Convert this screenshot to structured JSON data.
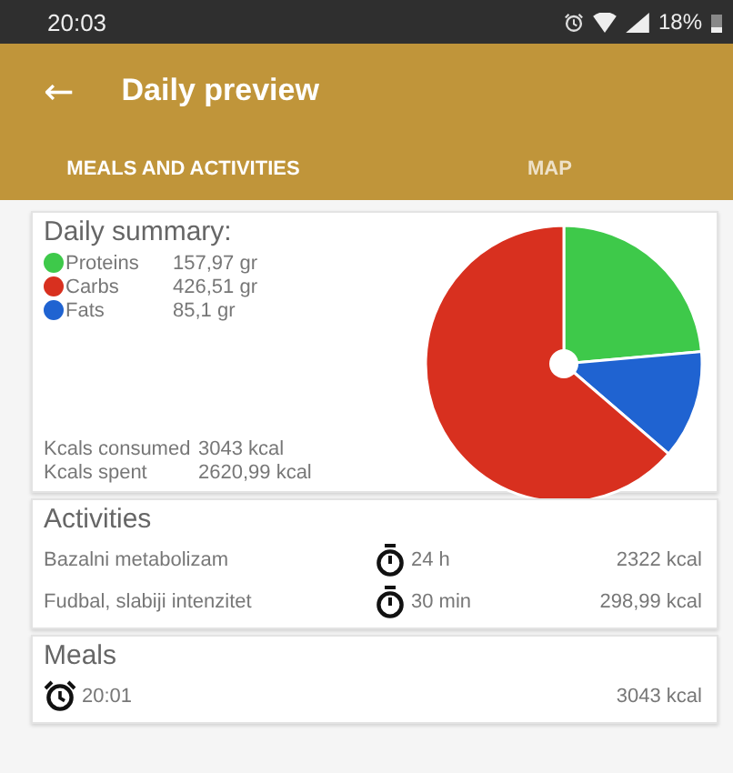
{
  "status_bar": {
    "time": "20:03",
    "battery": "18%"
  },
  "toolbar": {
    "back": "←",
    "title": "Daily preview"
  },
  "tabs": [
    {
      "label": "MEALS AND ACTIVITIES",
      "selected": true
    },
    {
      "label": "MAP",
      "selected": false
    }
  ],
  "summary": {
    "title": "Daily summary:",
    "macros": [
      {
        "amount": "157,97 gr",
        "color": "#3ec94a"
      },
      {
        "amount": "426,51 gr",
        "color": "#d8301f"
      },
      {
        "amount": "85,1 gr",
        "color": "#1f63d1"
      }
    ],
    "totals": [
      {
        "label": "Kcals consumed",
        "value": "3043 kcal"
      },
      {
        "label": "Kcals spent",
        "value": "2620,99 kcal"
      }
    ],
    "chart_data": {
      "type": "pie",
      "categories": [
        "Proteins",
        "Carbs",
        "Fats"
      ],
      "values": [
        23.59,
        63.7,
        12.71
      ]
    }
  },
  "activities": {
    "title": "Activities",
    "rows": [
      {
        "name": "Bazalni metabolizam",
        "duration": "24 h",
        "kcal": "2322 kcal"
      },
      {
        "name": "Fudbal, slabiji intenzitet",
        "duration": "30 min",
        "kcal": "298,99 kcal"
      }
    ]
  },
  "meals": {
    "title": "Meals",
    "rows": [
      {
        "time": "20:01",
        "kcal": "3043 kcal"
      }
    ]
  }
}
